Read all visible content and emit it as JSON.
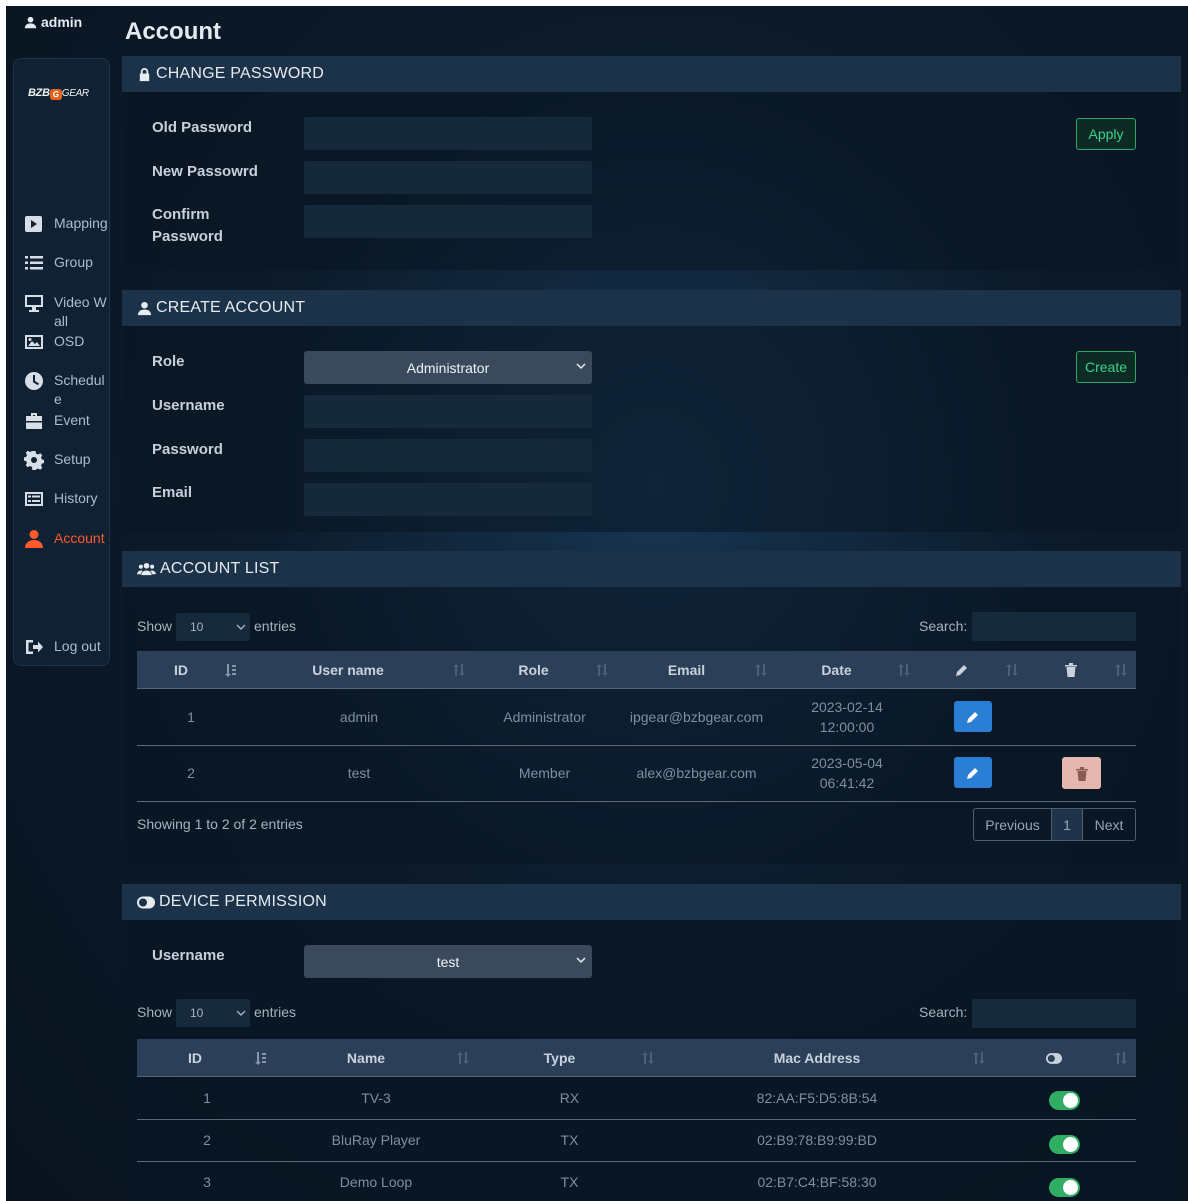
{
  "user": {
    "name": "admin"
  },
  "brand": {
    "bzb": "BZB",
    "o": "G",
    "gear": "GEAR"
  },
  "sidebar": {
    "items": [
      {
        "label": "Mapping",
        "icon": "play-square-icon"
      },
      {
        "label": "Group",
        "icon": "list-icon"
      },
      {
        "label": "Video Wall",
        "icon": "monitor-icon"
      },
      {
        "label": "OSD",
        "icon": "image-icon"
      },
      {
        "label": "Schedule",
        "icon": "clock-icon"
      },
      {
        "label": "Event",
        "icon": "briefcase-icon"
      },
      {
        "label": "Setup",
        "icon": "gear-icon"
      },
      {
        "label": "History",
        "icon": "history-icon"
      },
      {
        "label": "Account",
        "icon": "user-icon",
        "active": true
      }
    ],
    "logout": "Log out"
  },
  "page": {
    "title": "Account"
  },
  "change_password": {
    "header": "CHANGE PASSWORD",
    "old_label": "Old Password",
    "new_label": "New Passowrd",
    "confirm_label": "Confirm Password",
    "apply": "Apply"
  },
  "create_account": {
    "header": "CREATE ACCOUNT",
    "role_label": "Role",
    "role_value": "Administrator",
    "username_label": "Username",
    "password_label": "Password",
    "email_label": "Email",
    "create": "Create"
  },
  "account_list": {
    "header": "ACCOUNT LIST",
    "show": "Show",
    "length": "10",
    "entries": "entries",
    "search": "Search:",
    "columns": [
      "ID",
      "User name",
      "Role",
      "Email",
      "Date"
    ],
    "rows": [
      {
        "id": "1",
        "user": "admin",
        "role": "Administrator",
        "email": "ipgear@bzbgear.com",
        "date1": "2023-02-14",
        "date2": "12:00:00"
      },
      {
        "id": "2",
        "user": "test",
        "role": "Member",
        "email": "alex@bzbgear.com",
        "date1": "2023-05-04",
        "date2": "06:41:42"
      }
    ],
    "info": "Showing 1 to 2 of 2 entries",
    "prev": "Previous",
    "page": "1",
    "next": "Next"
  },
  "device_permission": {
    "header": "DEVICE PERMISSION",
    "username_label": "Username",
    "username_value": "test",
    "show": "Show",
    "length": "10",
    "entries": "entries",
    "search": "Search:",
    "columns": [
      "ID",
      "Name",
      "Type",
      "Mac Address"
    ],
    "rows": [
      {
        "id": "1",
        "name": "TV-3",
        "type": "RX",
        "mac": "82:AA:F5:D5:8B:54",
        "enabled": true
      },
      {
        "id": "2",
        "name": "BluRay Player",
        "type": "TX",
        "mac": "02:B9:78:B9:99:BD",
        "enabled": true
      },
      {
        "id": "3",
        "name": "Demo Loop",
        "type": "TX",
        "mac": "02:B7:C4:BF:58:30",
        "enabled": true
      }
    ]
  },
  "colors": {
    "accent_active": "#ff5a2a",
    "green": "#2fae64",
    "edit_blue": "#2a7fd4"
  }
}
